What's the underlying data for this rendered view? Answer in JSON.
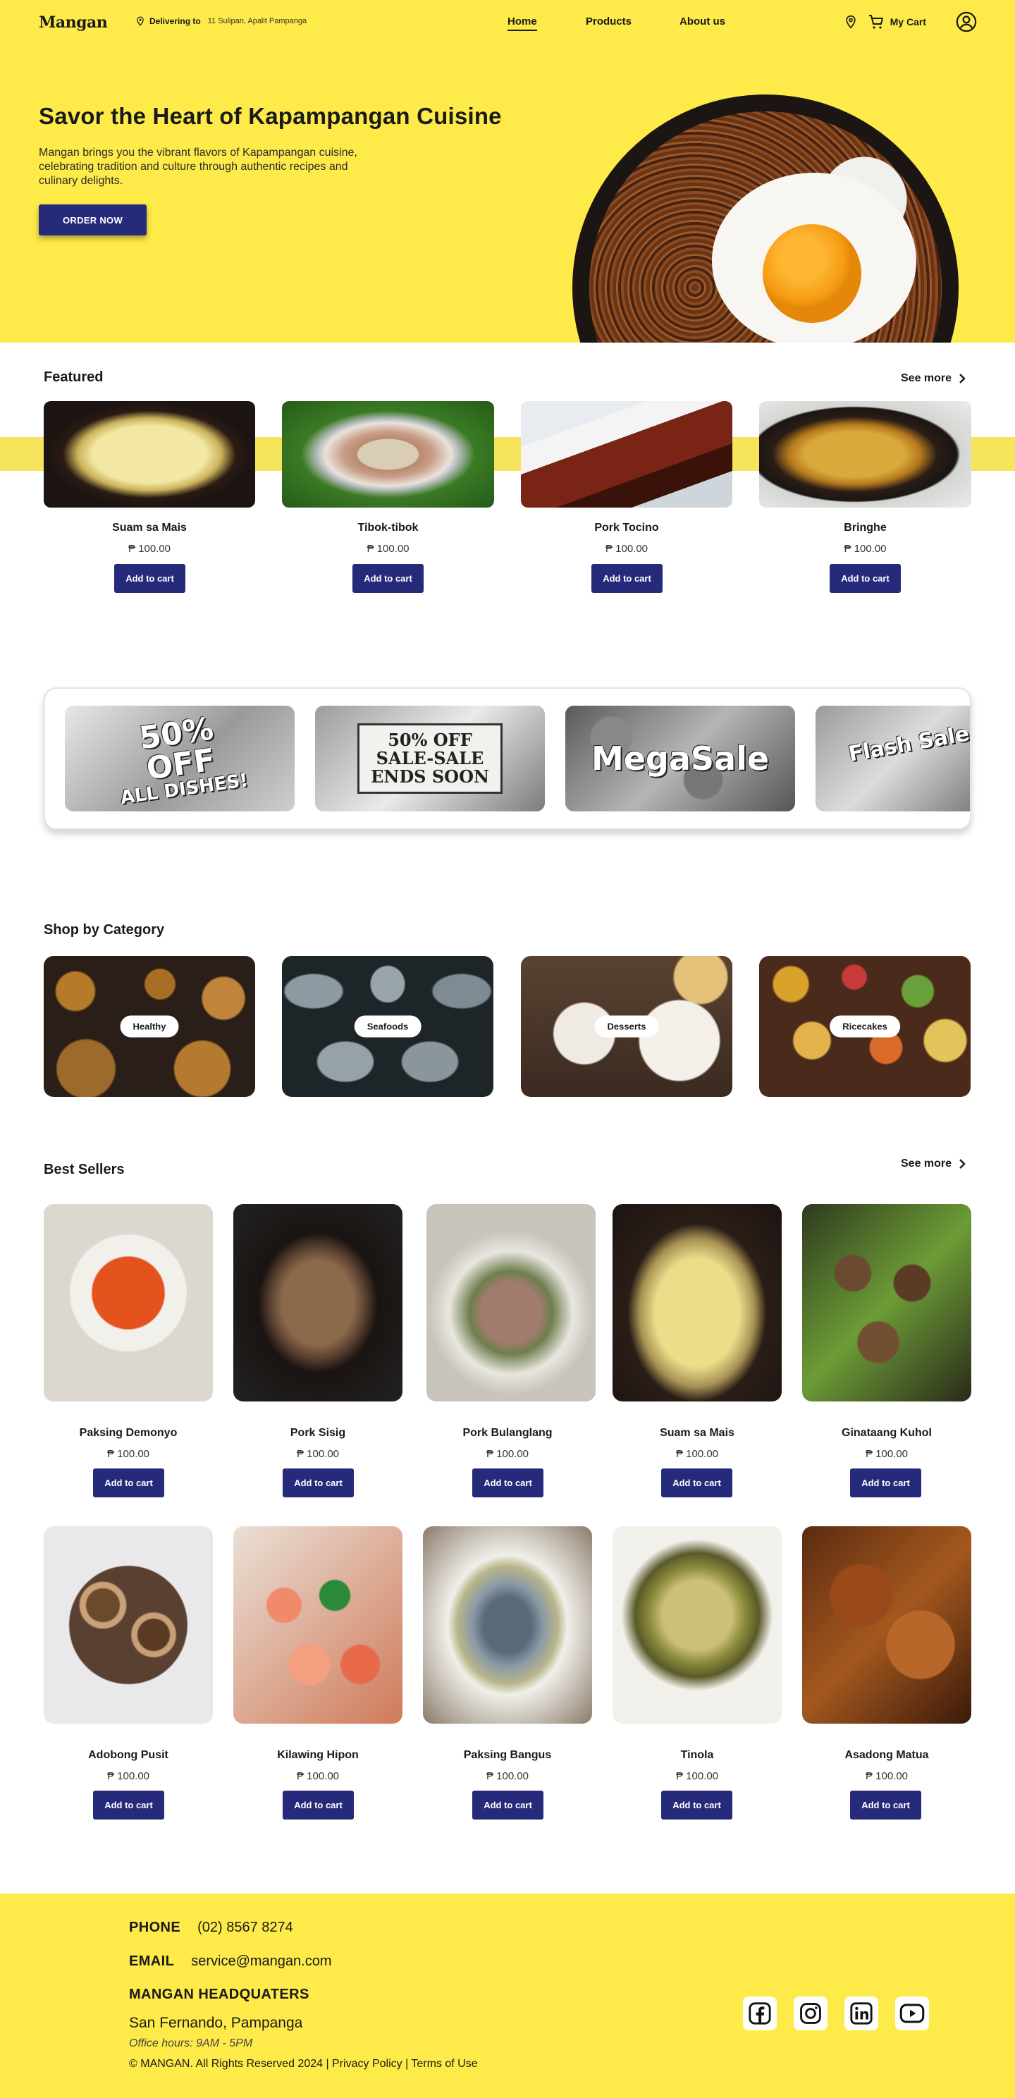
{
  "nav": {
    "logo": "Mangan",
    "delivering_label": "Delivering to",
    "delivering_address": "11 Sulipan, Apalit Pampanga",
    "links": [
      "Home",
      "Products",
      "About us"
    ],
    "cart_label": "My Cart"
  },
  "hero": {
    "title": "Savor the Heart of Kapampangan Cuisine",
    "subtitle": "Mangan brings you the vibrant flavors of Kapampangan cuisine, celebrating tradition and culture through authentic recipes and culinary delights.",
    "cta": "ORDER NOW"
  },
  "featured": {
    "title": "Featured",
    "see_more": "See more",
    "items": [
      {
        "name": "Suam sa Mais",
        "price": "₱ 100.00",
        "button": "Add to cart"
      },
      {
        "name": "Tibok-tibok",
        "price": "₱ 100.00",
        "button": "Add to cart"
      },
      {
        "name": "Pork Tocino",
        "price": "₱ 100.00",
        "button": "Add to cart"
      },
      {
        "name": "Bringhe",
        "price": "₱ 100.00",
        "button": "Add to cart"
      }
    ]
  },
  "promos": {
    "p1": [
      "50%",
      "OFF",
      "ALL DISHES!"
    ],
    "p2": [
      "50% OFF",
      "SALE-SALE",
      "ENDS SOON"
    ],
    "p3": "MegaSale",
    "p4": "Flash Sale"
  },
  "categories": {
    "title": "Shop by Category",
    "items": [
      "Healthy",
      "Seafoods",
      "Desserts",
      "Ricecakes"
    ]
  },
  "best_sellers": {
    "title": "Best Sellers",
    "see_more": "See more",
    "items": [
      {
        "name": "Paksing Demonyo",
        "price": "₱ 100.00",
        "button": "Add to cart"
      },
      {
        "name": "Pork Sisig",
        "price": "₱ 100.00",
        "button": "Add to cart"
      },
      {
        "name": "Pork Bulanglang",
        "price": "₱ 100.00",
        "button": "Add to cart"
      },
      {
        "name": "Suam sa Mais",
        "price": "₱ 100.00",
        "button": "Add to cart"
      },
      {
        "name": "Ginataang Kuhol",
        "price": "₱ 100.00",
        "button": "Add to cart"
      },
      {
        "name": "Adobong Pusit",
        "price": "₱ 100.00",
        "button": "Add to cart"
      },
      {
        "name": "Kilawing Hipon",
        "price": "₱ 100.00",
        "button": "Add to cart"
      },
      {
        "name": "Paksing Bangus",
        "price": "₱ 100.00",
        "button": "Add to cart"
      },
      {
        "name": "Tinola",
        "price": "₱ 100.00",
        "button": "Add to cart"
      },
      {
        "name": "Asadong Matua",
        "price": "₱ 100.00",
        "button": "Add to cart"
      }
    ]
  },
  "footer": {
    "phone_label": "PHONE",
    "phone": "(02) 8567 8274",
    "email_label": "EMAIL",
    "email": "service@mangan.com",
    "hq_label": "MANGAN HEADQUATERS",
    "address": "San Fernando, Pampanga",
    "hours": "Office hours: 9AM - 5PM",
    "copyright": "© MANGAN. All Rights Reserved 2024 | Privacy Policy | Terms of Use"
  },
  "colors": {
    "brand_yellow": "#feea48",
    "button_navy": "#252b7a"
  },
  "icons": [
    "location-pin-icon",
    "cart-icon",
    "user-icon",
    "chevron-right-icon",
    "facebook-icon",
    "instagram-icon",
    "linkedin-icon",
    "youtube-icon"
  ]
}
